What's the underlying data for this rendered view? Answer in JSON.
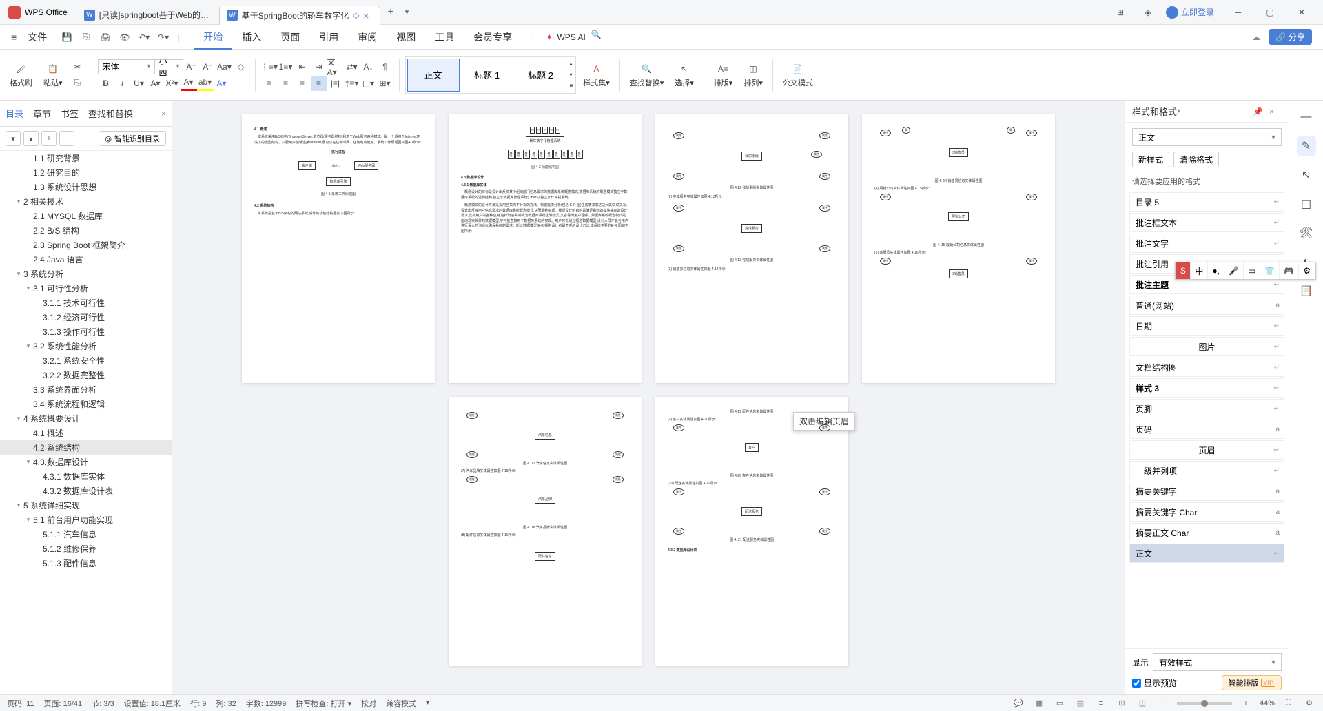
{
  "titlebar": {
    "app_name": "WPS Office",
    "tabs": [
      {
        "label": "[只读]springboot基于Web的车辆",
        "active": false
      },
      {
        "label": "基于SpringBoot的轿车数字化",
        "active": true
      }
    ],
    "login_label": "立即登录"
  },
  "menubar": {
    "file": "文件",
    "tabs": [
      "开始",
      "插入",
      "页面",
      "引用",
      "审阅",
      "视图",
      "工具",
      "会员专享"
    ],
    "active_tab": "开始",
    "ai_label": "WPS AI"
  },
  "ribbon": {
    "format_painter": "格式刷",
    "paste": "粘贴",
    "font_name": "宋体",
    "font_size": "小四",
    "style_set": "样式集",
    "find_replace": "查找替换",
    "select": "选择",
    "layout": "排版",
    "sort": "排列",
    "gov_mode": "公文模式",
    "styles": [
      {
        "label": "正文",
        "active": true
      },
      {
        "label": "标题 1",
        "active": false
      },
      {
        "label": "标题 2",
        "active": false
      }
    ],
    "share": "分享"
  },
  "leftpanel": {
    "tabs": [
      "目录",
      "章节",
      "书签",
      "查找和替换"
    ],
    "active_tab": "目录",
    "smart_btn": "智能识别目录",
    "toc": [
      {
        "level": 1,
        "text": "1.1 研究背景"
      },
      {
        "level": 1,
        "text": "1.2 研究目的"
      },
      {
        "level": 1,
        "text": "1.3 系统设计思想"
      },
      {
        "level": 0,
        "text": "2 相关技术",
        "exp": true
      },
      {
        "level": 1,
        "text": "2.1 MYSQL 数据库"
      },
      {
        "level": 1,
        "text": "2.2 B/S 结构"
      },
      {
        "level": 1,
        "text": "2.3 Spring Boot 框架简介"
      },
      {
        "level": 1,
        "text": "2.4 Java 语言"
      },
      {
        "level": 0,
        "text": "3 系统分析",
        "exp": true
      },
      {
        "level": 1,
        "text": "3.1 可行性分析",
        "exp": true
      },
      {
        "level": 2,
        "text": "3.1.1 技术可行性"
      },
      {
        "level": 2,
        "text": "3.1.2 经济可行性"
      },
      {
        "level": 2,
        "text": "3.1.3 操作可行性"
      },
      {
        "level": 1,
        "text": "3.2 系统性能分析",
        "exp": true
      },
      {
        "level": 2,
        "text": "3.2.1 系统安全性"
      },
      {
        "level": 2,
        "text": "3.2.2 数据完整性"
      },
      {
        "level": 1,
        "text": "3.3 系统界面分析"
      },
      {
        "level": 1,
        "text": "3.4 系统流程和逻辑"
      },
      {
        "level": 0,
        "text": "4 系统概要设计",
        "exp": true
      },
      {
        "level": 1,
        "text": "4.1 概述"
      },
      {
        "level": 1,
        "text": "4.2 系统结构",
        "selected": true
      },
      {
        "level": 1,
        "text": "4.3.数据库设计",
        "exp": true
      },
      {
        "level": 2,
        "text": "4.3.1 数据库实体"
      },
      {
        "level": 2,
        "text": "4.3.2 数据库设计表"
      },
      {
        "level": 0,
        "text": "5 系统详细实现",
        "exp": true
      },
      {
        "level": 1,
        "text": "5.1 前台用户功能实现",
        "exp": true
      },
      {
        "level": 2,
        "text": "5.1.1 汽车信息"
      },
      {
        "level": 2,
        "text": "5.1.2 维修保养"
      },
      {
        "level": 2,
        "text": "5.1.3 配件信息"
      }
    ]
  },
  "document": {
    "tooltip": "双击编辑页眉",
    "page1": {
      "h1": "4.1 概述",
      "p1": "本系统采用B/S结构(Browser/Server,浏览器/服务器结构)和基于Web服务两种模式。是一个适用于Internet环境下的模型结构。只要用户能够连接Internet,便可以在任何时间、任何地点使用。系统工作原理图如图4-1所示:",
      "exec": "执行过程",
      "box_client": "客户端",
      "box_server": "Web服务器",
      "box_db": "数据库引擎",
      "arrow1": "请求",
      "arrow2": "处理",
      "fig1": "图 4-1 系统工作原理图",
      "h2": "4.2 系统结构",
      "p2": "本系统是基于B/S架构的网站系统,设计的功能结构图如下图所示:"
    },
    "page2": {
      "fig": "图 4-2 功能结构图",
      "h1": "4.3.数据库设计",
      "h2": "4.3.1 数据库实体",
      "p1": "概念设计的目标是设计出反映某个组织部门信息需求的数据库系统概念模式,数据库系统的概念模式独立于数据库系统的逻辑结构,独立于数据库管理系统(DBMS),独立于计算机系统。",
      "p2": "概念模式的设计方法是采用自顶向下分析的方法。根据需求分析(包括 E-R 图)生成表来表达之间的关联关系,设计出反映用户信息需求的数据库系统概念模式,从而最终实现。我们设计的目的是满足系统的模块抽象的设计需求,支持用户的各种应用,这样既容易转变为数据库系统逻辑模式,又容易为用户理解。数据库系统概念模式是面向现实世界的数据模型,不可能直接用于数据库系统的实现。用户只有通过概念数据模型,设计人员才能与用户进行深入的沟通以确保系统的需求。所以数据模型 E-R 提供设计者最直观的设计方法,本系统主要的E-R 图如下图所示:"
    },
    "page3": {
      "center_top": "我的事版",
      "fig_top": "图 4.12 我的事版实体属性图",
      "line1": "(2) 完成服务实体属性如图 4.13所示:",
      "center_mid": "完成服务",
      "fig_mid": "图 4.13 完成服务实体属性图",
      "line2": "(3) 销售员信息实体属性如图 4.14所示:"
    },
    "page4": {
      "center1": "3销售员",
      "fig1": "图 4. 14 销售员信息实体属性图",
      "line1": "(4) 展销公司实体属性如图 4.15所示:",
      "center2": "展销公司",
      "fig2": "图 4. 15 展销公司信息实体属性图",
      "line2": "(5) 客服员实体属性如图 4.16所示:",
      "center3": "3销售员"
    },
    "page5": {
      "center1": "汽车信息",
      "fig1": "图 4. 17 汽车信息实体属性图",
      "line1": "(7) 汽车品牌实体属性如图 4.18所示:",
      "center2": "汽车品牌",
      "fig2": "图 4. 18 汽车品牌实体属性图",
      "line2": "(8) 配件信息实体属性如图 4.19所示:",
      "center3": "配件信息"
    },
    "page6": {
      "fig0": "图 4.19 配件信息实体属性图",
      "line1": "(9) 客户实体属性如图 4.20所示:",
      "center1": "客户",
      "fig1": "图 4.20 客户信息实体属性图",
      "line2": "(10) 配送实体属性如图 4.21所示:",
      "center2": "配送服务",
      "fig2": "图 4. 21 配送服务实体属性图",
      "h1": "4.3.2 数据库设计表"
    }
  },
  "rightpanel": {
    "title": "样式和格式",
    "current_style": "正文",
    "new_style": "新样式",
    "clear_fmt": "清除格式",
    "hint": "请选择要应用的格式",
    "styles": [
      {
        "label": "目录 5",
        "badge": "↵"
      },
      {
        "label": "批注框文本",
        "badge": "↵"
      },
      {
        "label": "批注文字",
        "badge": "↵"
      },
      {
        "label": "批注引用",
        "badge": "a"
      },
      {
        "label": "批注主题",
        "badge": "↵",
        "bold": true
      },
      {
        "label": "普通(网站)",
        "badge": "a"
      },
      {
        "label": "日期",
        "badge": "↵"
      },
      {
        "label": "图片",
        "badge": "↵",
        "center": true
      },
      {
        "label": "文档结构图",
        "badge": "↵"
      },
      {
        "label": "样式 3",
        "badge": "↵",
        "bold": true
      },
      {
        "label": "页脚",
        "badge": "↵"
      },
      {
        "label": "页码",
        "badge": "a"
      },
      {
        "label": "页眉",
        "badge": "↵",
        "center": true
      },
      {
        "label": "一级并列项",
        "badge": "↵"
      },
      {
        "label": "摘要关键字",
        "badge": "a"
      },
      {
        "label": "摘要关键字 Char",
        "badge": "a"
      },
      {
        "label": "摘要正文 Char",
        "badge": "a"
      },
      {
        "label": "正文",
        "badge": "↵",
        "selected": true
      }
    ],
    "display_label": "显示",
    "display_value": "有效样式",
    "preview_check": "显示预览",
    "smart_layout": "智能排版"
  },
  "statusbar": {
    "page_num": "页码: 11",
    "page_of": "页面: 16/41",
    "section": "节: 3/3",
    "ruler": "设置值: 18.1厘米",
    "row": "行: 9",
    "col": "列: 32",
    "word_count": "字数: 12999",
    "spell": "拼写检查: 打开",
    "proof": "校对",
    "compat": "兼容模式",
    "zoom": "44%"
  },
  "ime": {
    "items": [
      "中",
      "●,",
      "🎤",
      "▭",
      "👕",
      "🎮",
      "⚙"
    ]
  }
}
